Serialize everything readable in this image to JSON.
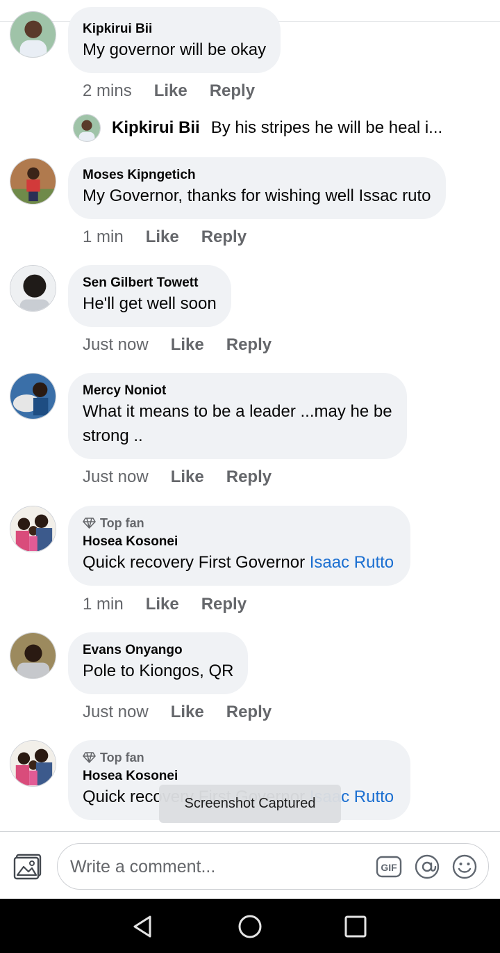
{
  "comments": [
    {
      "author": "Kipkirui Bii",
      "text": "My governor will be okay",
      "time": "2 mins",
      "like": "Like",
      "reply": "Reply"
    },
    {
      "author": "Moses Kipngetich",
      "text": "My Governor, thanks for wishing well Issac ruto",
      "time": "1 min",
      "like": "Like",
      "reply": "Reply"
    },
    {
      "author": "Sen Gilbert Towett",
      "text": "He'll get well soon",
      "time": "Just now",
      "like": "Like",
      "reply": "Reply"
    },
    {
      "author": "Mercy Noniot",
      "text_line1": "What it means to be  a leader ...may he be",
      "text_line2": "strong ..",
      "time": "Just now",
      "like": "Like",
      "reply": "Reply"
    },
    {
      "badge": "Top fan",
      "author": "Hosea Kosonei",
      "text": "Quick recovery First Governor ",
      "mention": "Isaac Rutto",
      "time": "1 min",
      "like": "Like",
      "reply": "Reply"
    },
    {
      "author": "Evans Onyango",
      "text": "Pole to Kiongos, QR",
      "time": "Just now",
      "like": "Like",
      "reply": "Reply"
    },
    {
      "badge": "Top fan",
      "author": "Hosea Kosonei",
      "text": "Quick recovery First Governor ",
      "mention": "Isaac Rutto"
    }
  ],
  "reply_preview": {
    "author": "Kipkirui Bii",
    "text": "By his stripes he will be heal i..."
  },
  "toast": "Screenshot Captured",
  "composer": {
    "placeholder": "Write a comment...",
    "photo_icon": "photo-icon",
    "gif_icon": "gif-icon",
    "mention_icon": "at-mention-icon",
    "emoji_icon": "emoji-icon"
  },
  "colors": {
    "accent": "#1b6fd1",
    "bubble": "#f0f2f5",
    "muted": "#65676b"
  }
}
